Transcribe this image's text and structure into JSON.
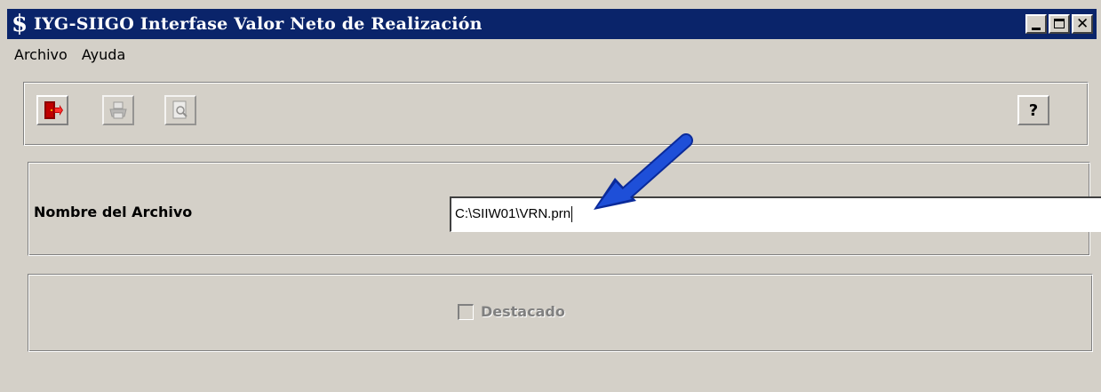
{
  "window": {
    "title": "IYG-SIIGO  Interfase Valor Neto de Realización",
    "icon": "dollar-sign-icon",
    "title_color": "#0a246a"
  },
  "menu": {
    "items": [
      {
        "label": "Archivo"
      },
      {
        "label": "Ayuda"
      }
    ]
  },
  "toolbar": {
    "buttons": [
      {
        "icon": "exit-door-icon",
        "enabled": true
      },
      {
        "icon": "print-icon",
        "enabled": false
      },
      {
        "icon": "print-preview-icon",
        "enabled": false
      }
    ],
    "help": {
      "icon": "help-question-icon",
      "glyph": "?"
    }
  },
  "form": {
    "filename_label": "Nombre del Archivo",
    "filename_value": "C:\\SIIW01\\VRN.prn",
    "destacado_label": "Destacado",
    "destacado_checked": false,
    "destacado_enabled": false
  },
  "annotation": {
    "icon": "blue-arrow-icon",
    "color": "#1e4fd8"
  }
}
